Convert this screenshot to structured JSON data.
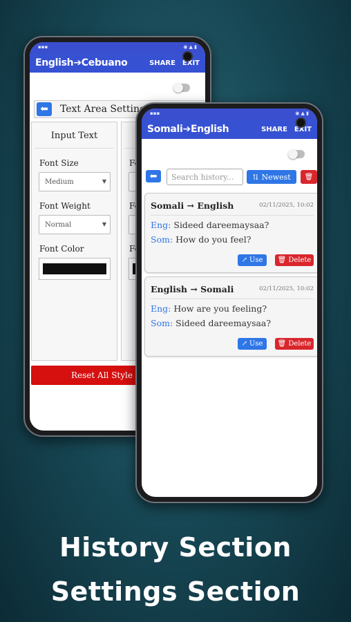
{
  "settings_phone": {
    "app_title": "English➔Cebuano",
    "share_label": "SHARE",
    "exit_label": "EXIT",
    "section_title": "Text Area Settings",
    "columns": [
      {
        "heading": "Input Text",
        "font_size_label": "Font Size",
        "font_size_value": "Medium",
        "font_weight_label": "Font Weight",
        "font_weight_value": "Normal",
        "font_color_label": "Font Color",
        "font_color_value": "#111111"
      },
      {
        "heading": "O",
        "font_size_label": "Fo",
        "font_weight_label": "Fo",
        "font_color_label": "Fo"
      }
    ],
    "reset_label": "Reset All Style S"
  },
  "history_phone": {
    "app_title": "Somali➔English",
    "share_label": "SHARE",
    "exit_label": "EXIT",
    "search_placeholder": "Search history...",
    "sort_label": "Newest",
    "cards": [
      {
        "title": "Somali → English",
        "date": "02/11/2025, 10:02",
        "line1_tag": "Eng:",
        "line1_text": "Sideed dareemaysaa?",
        "line2_tag": "Som:",
        "line2_text": "How do you feel?",
        "use_label": "Use",
        "delete_label": "Delete"
      },
      {
        "title": "English → Somali",
        "date": "02/11/2025, 10:02",
        "line1_tag": "Eng:",
        "line1_text": "How are you feeling?",
        "line2_tag": "Som:",
        "line2_text": "Sideed dareemaysaa?",
        "use_label": "Use",
        "delete_label": "Delete"
      }
    ]
  },
  "captions": {
    "line1": "History Section",
    "line2": "Settings Section"
  },
  "colors": {
    "appbar": "#3651d2",
    "accent_blue": "#2f76e6",
    "danger_red": "#d9262d",
    "reset_red": "#d60f0f"
  }
}
